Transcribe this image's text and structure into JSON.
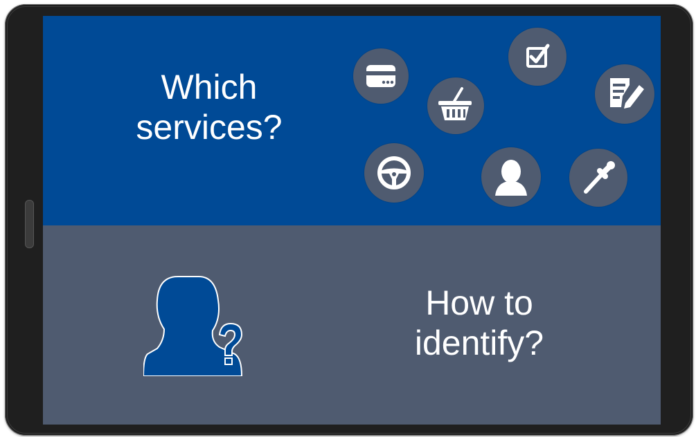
{
  "top_panel": {
    "heading_line1": "Which",
    "heading_line2": "services?",
    "icons": [
      "credit-card-icon",
      "shopping-basket-icon",
      "checkbox-icon",
      "edit-document-icon",
      "steering-wheel-icon",
      "person-icon",
      "pipette-icon"
    ]
  },
  "bottom_panel": {
    "heading_line1": "How to",
    "heading_line2": "identify?",
    "icon": "person-question-icon"
  },
  "colors": {
    "top_background": "#004a96",
    "bottom_background": "#4f5b70",
    "icon_circle": "#4f5b70",
    "text": "#ffffff"
  }
}
